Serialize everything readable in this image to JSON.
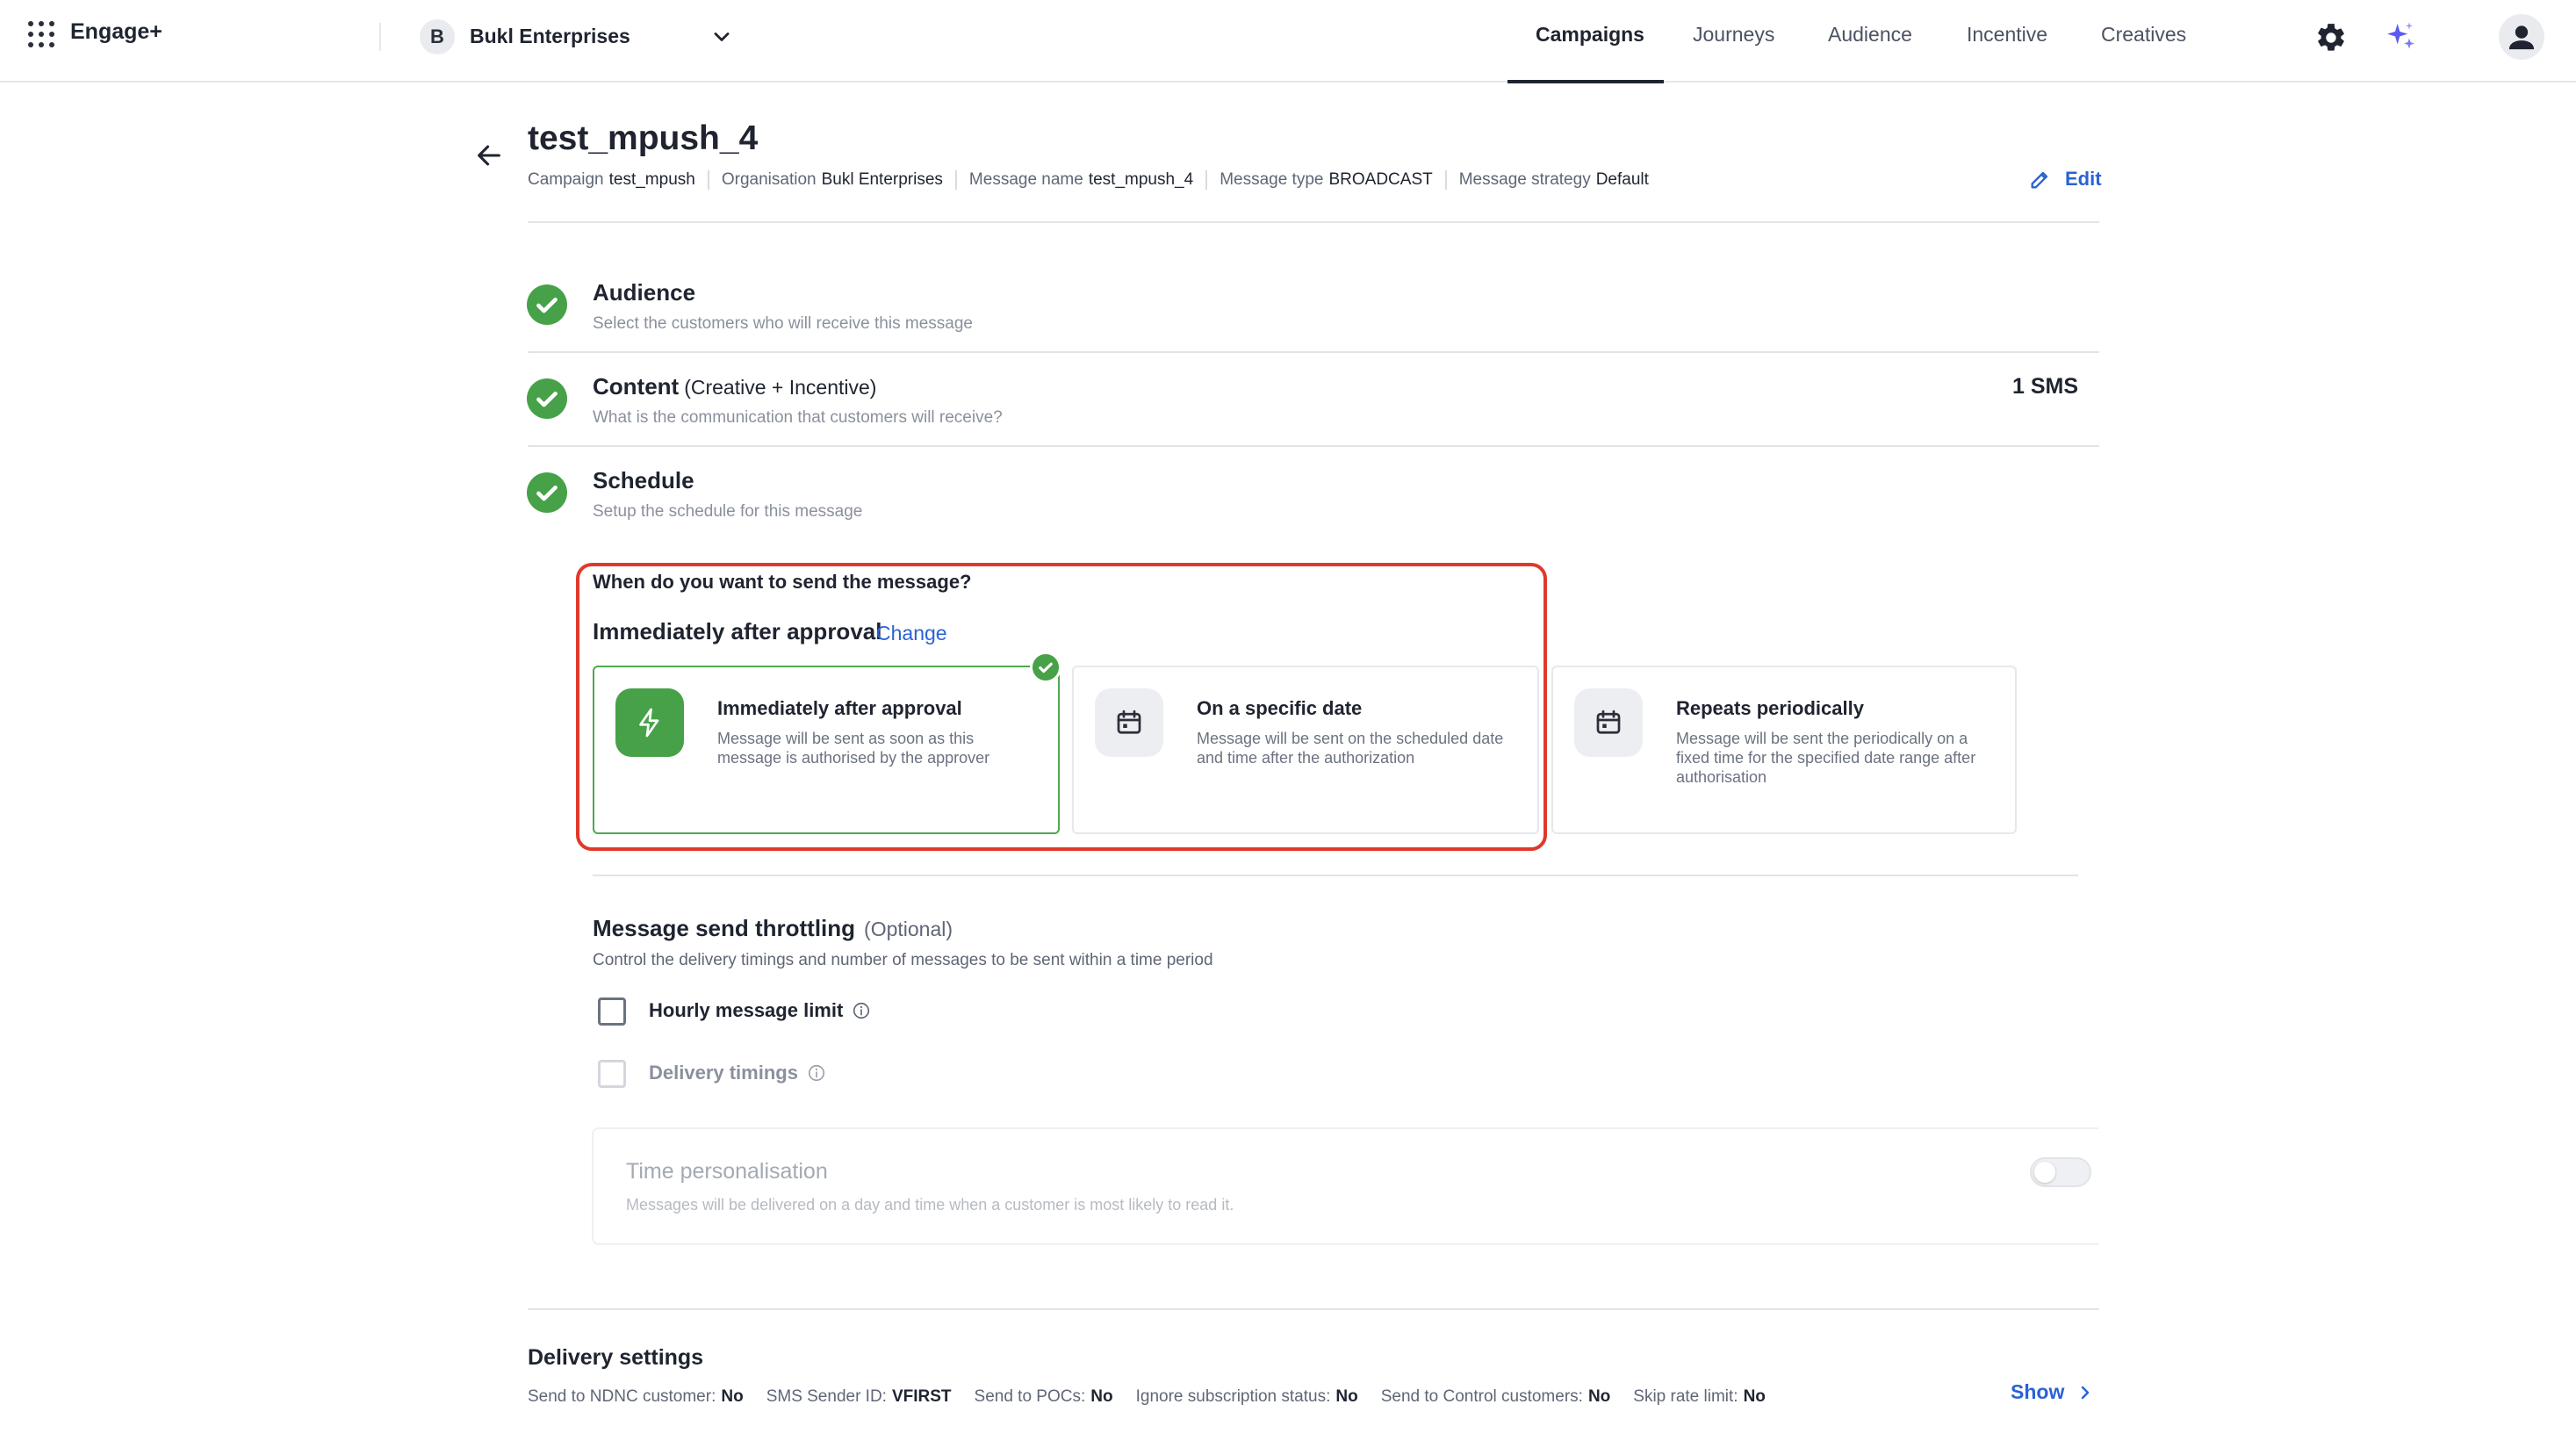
{
  "app": {
    "name": "Engage+"
  },
  "org": {
    "initial": "B",
    "name": "Bukl Enterprises"
  },
  "nav": {
    "tabs": [
      {
        "label": "Campaigns"
      },
      {
        "label": "Journeys"
      },
      {
        "label": "Audience"
      },
      {
        "label": "Incentive"
      },
      {
        "label": "Creatives"
      }
    ],
    "active_tab": "Campaigns"
  },
  "header": {
    "title": "test_mpush_4",
    "meta": [
      {
        "label": "Campaign",
        "value": "test_mpush"
      },
      {
        "label": "Organisation",
        "value": "Bukl Enterprises"
      },
      {
        "label": "Message name",
        "value": "test_mpush_4"
      },
      {
        "label": "Message type",
        "value": "BROADCAST"
      },
      {
        "label": "Message strategy",
        "value": "Default"
      }
    ],
    "edit_label": "Edit"
  },
  "steps": {
    "audience": {
      "title": "Audience",
      "subtitle": "Select the customers who will receive this message"
    },
    "content": {
      "title": "Content",
      "title_suffix": "(Creative + Incentive)",
      "subtitle": "What is the communication that customers will receive?",
      "count": "1 SMS"
    },
    "schedule": {
      "title": "Schedule",
      "subtitle": "Setup the schedule for this message"
    }
  },
  "schedule": {
    "question": "When do you want to send the message?",
    "selected": "Immediately after approval",
    "change_label": "Change",
    "options": [
      {
        "title": "Immediately after approval",
        "description": "Message will be sent as soon as this message is authorised by the approver",
        "icon": "lightning-icon",
        "selected": true
      },
      {
        "title": "On a specific date",
        "description": "Message will be sent on the scheduled date and time after the authorization",
        "icon": "calendar-icon",
        "selected": false
      },
      {
        "title": "Repeats periodically",
        "description": "Message will be sent the periodically on a fixed time for the specified date range after authorisation",
        "icon": "calendar-icon",
        "selected": false
      }
    ]
  },
  "throttling": {
    "title": "Message send throttling",
    "optional": "(Optional)",
    "subtitle": "Control the delivery timings and number of messages to be sent within a time period",
    "hourly_label": "Hourly message limit",
    "delivery_label": "Delivery timings"
  },
  "time_personalisation": {
    "title": "Time personalisation",
    "subtitle": "Messages will be delivered on a day and time when a customer is most likely to read it.",
    "enabled": false
  },
  "delivery_settings": {
    "title": "Delivery settings",
    "items": [
      {
        "label": "Send to NDNC customer:",
        "value": "No"
      },
      {
        "label": "SMS Sender ID:",
        "value": "VFIRST"
      },
      {
        "label": "Send to POCs:",
        "value": "No"
      },
      {
        "label": "Ignore subscription status:",
        "value": "No"
      },
      {
        "label": "Send to Control customers:",
        "value": "No"
      },
      {
        "label": "Skip rate limit:",
        "value": "No"
      }
    ],
    "show_label": "Show"
  },
  "colors": {
    "accent": "#2a62d6",
    "success": "#47a148",
    "highlight": "#e0392b"
  }
}
